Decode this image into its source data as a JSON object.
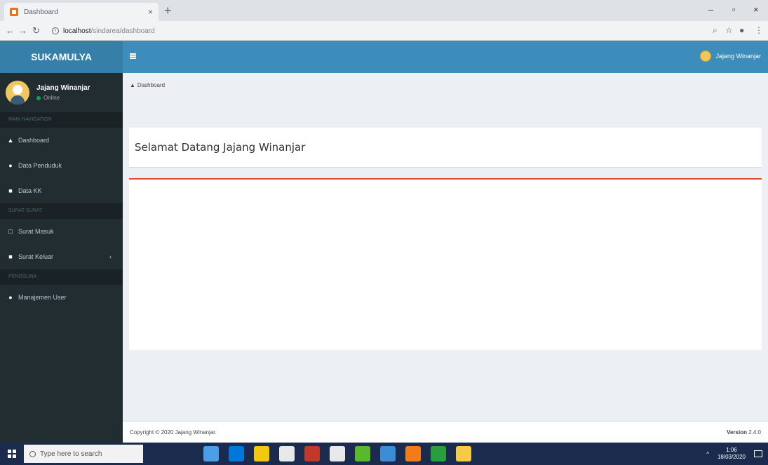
{
  "browser": {
    "tab_title": "Dashboard",
    "tab_close": "×",
    "new_tab": "+",
    "url_host": "localhost",
    "url_path": "/sindarea/dashboard",
    "win_min": "–",
    "win_max": "▫",
    "win_close": "×"
  },
  "app": {
    "logo": "SUKAMULYA",
    "user_name": "Jajang Winanjar",
    "user_status": "Online",
    "sidebar": {
      "header1": "MAIN NAVIGATION",
      "items_main": [
        {
          "label": "Dashboard",
          "icon": "▲"
        },
        {
          "label": "Data Penduduk",
          "icon": "●"
        },
        {
          "label": "Data KK",
          "icon": "■"
        }
      ],
      "header2": "SURAT-SURAT",
      "items_surat": [
        {
          "label": "Surat Masuk",
          "icon": "□"
        },
        {
          "label": "Surat Keluar",
          "icon": "■",
          "chevron": "‹"
        }
      ],
      "header3": "PENGGUNA",
      "items_user": [
        {
          "label": "Manajemen User",
          "icon": "●"
        }
      ]
    },
    "breadcrumb": "Dashboard",
    "welcome": "Selamat Datang Jajang Winanjar",
    "footer_copyright": "Copyright © 2020 Jajang Winanjar.",
    "footer_version_label": "Version",
    "footer_version_value": "2.4.0"
  },
  "taskbar": {
    "search_placeholder": "Type here to search",
    "time": "1:06",
    "date": "18/03/2020",
    "icon_colors": [
      "#4d9ee8",
      "#0078d7",
      "#f2c811",
      "#e8e8e8",
      "#c0392b",
      "#e8e8e8",
      "#5ab82d",
      "#3c8dd6",
      "#f07d1a",
      "#2a9d3f",
      "#f7c948"
    ]
  },
  "colors": {
    "logo_bg": "#367fa9",
    "topnav_bg": "#3c8dbc",
    "sidebar_bg": "#222d32",
    "box_accent": "#dd4b39"
  }
}
